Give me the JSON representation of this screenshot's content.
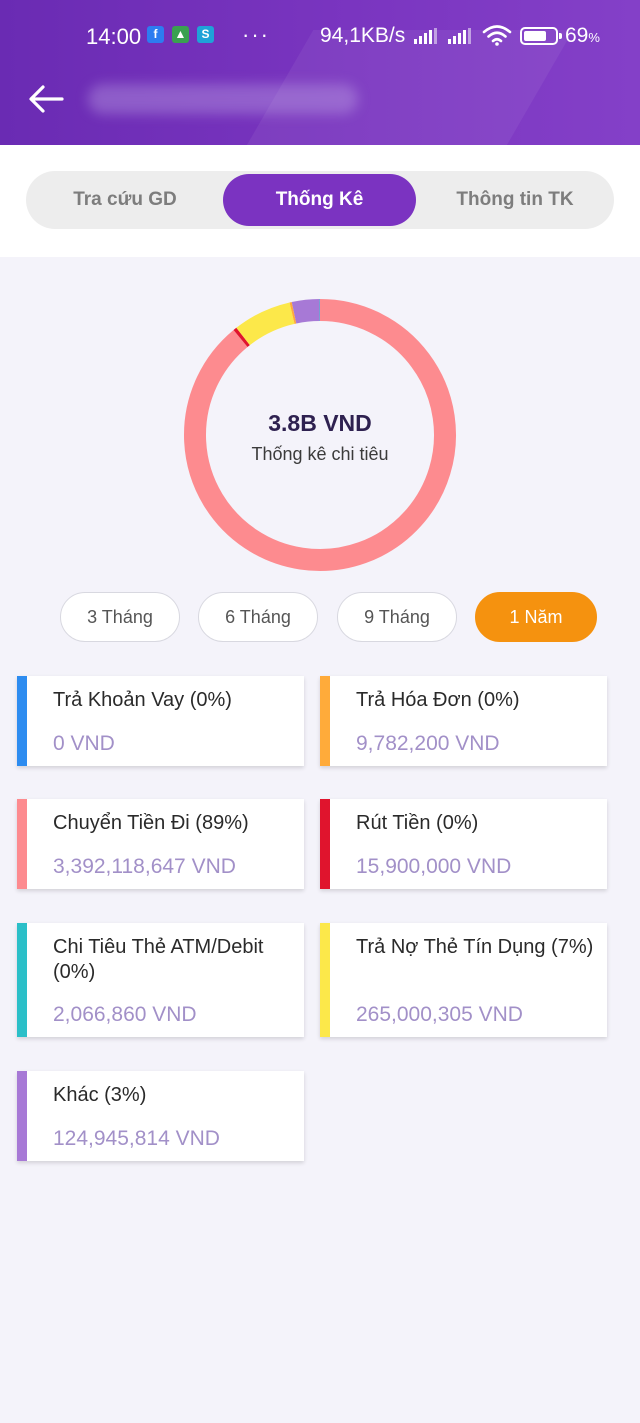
{
  "status_bar": {
    "time": "14:00",
    "speed": "94,1KB/s",
    "battery": "69",
    "battery_unit": "%",
    "notification_icons": [
      "facebook-icon",
      "shield-icon",
      "skype-icon"
    ]
  },
  "header": {
    "back_icon": "arrow-left-icon"
  },
  "tabs": [
    {
      "label": "Tra cứu GD",
      "active": false
    },
    {
      "label": "Thống Kê",
      "active": true
    },
    {
      "label": "Thông tin TK",
      "active": false
    }
  ],
  "summary": {
    "total": "3.8B VND",
    "caption": "Thống kê chi tiêu"
  },
  "chart_data": {
    "type": "pie",
    "values": [
      89,
      0,
      7,
      0,
      3,
      0,
      0
    ],
    "slices": [
      {
        "category": "Chuyển Tiền Đi",
        "percent": 89,
        "amount": 3392118647,
        "color": "#fd8b8f"
      },
      {
        "category": "Rút Tiền",
        "percent": 0,
        "amount": 15900000,
        "color": "#e0142d"
      },
      {
        "category": "Trả Nợ Thẻ Tín Dụng",
        "percent": 7,
        "amount": 265000305,
        "color": "#fce84a"
      },
      {
        "category": "Trả Hóa Đơn",
        "percent": 0,
        "amount": 9782200,
        "color": "#ffab3a"
      },
      {
        "category": "Khác",
        "percent": 3,
        "amount": 124945814,
        "color": "#a779d6"
      },
      {
        "category": "Chi Tiêu Thẻ ATM/Debit",
        "percent": 0,
        "amount": 2066860,
        "color": "#2bbfc8"
      },
      {
        "category": "Trả Khoản Vay",
        "percent": 0,
        "amount": 0,
        "color": "#2d8cf0"
      }
    ]
  },
  "periods": [
    {
      "label": "3 Tháng",
      "active": false
    },
    {
      "label": "6 Tháng",
      "active": false
    },
    {
      "label": "9 Tháng",
      "active": false
    },
    {
      "label": "1 Năm",
      "active": true
    }
  ],
  "categories": [
    {
      "title": "Trả Khoản Vay (0%)",
      "amount": "0 VND",
      "color": "#2d8cf0"
    },
    {
      "title": "Trả Hóa Đơn (0%)",
      "amount": "9,782,200 VND",
      "color": "#ffab3a"
    },
    {
      "title": "Chuyển Tiền Đi (89%)",
      "amount": "3,392,118,647 VND",
      "color": "#fd8b8f"
    },
    {
      "title": "Rút Tiền (0%)",
      "amount": "15,900,000 VND",
      "color": "#e0142d"
    },
    {
      "title": "Chi Tiêu Thẻ ATM/Debit (0%)",
      "amount": "2,066,860 VND",
      "color": "#2bbfc8"
    },
    {
      "title": "Trả Nợ Thẻ Tín Dụng (7%)",
      "amount": "265,000,305 VND",
      "color": "#fce84a"
    },
    {
      "title": "Khác (3%)",
      "amount": "124,945,814 VND",
      "color": "#a779d6"
    }
  ],
  "colors": {
    "primary": "#7b33c1",
    "accent_orange": "#f5920f",
    "amount_text": "#a290c8"
  }
}
